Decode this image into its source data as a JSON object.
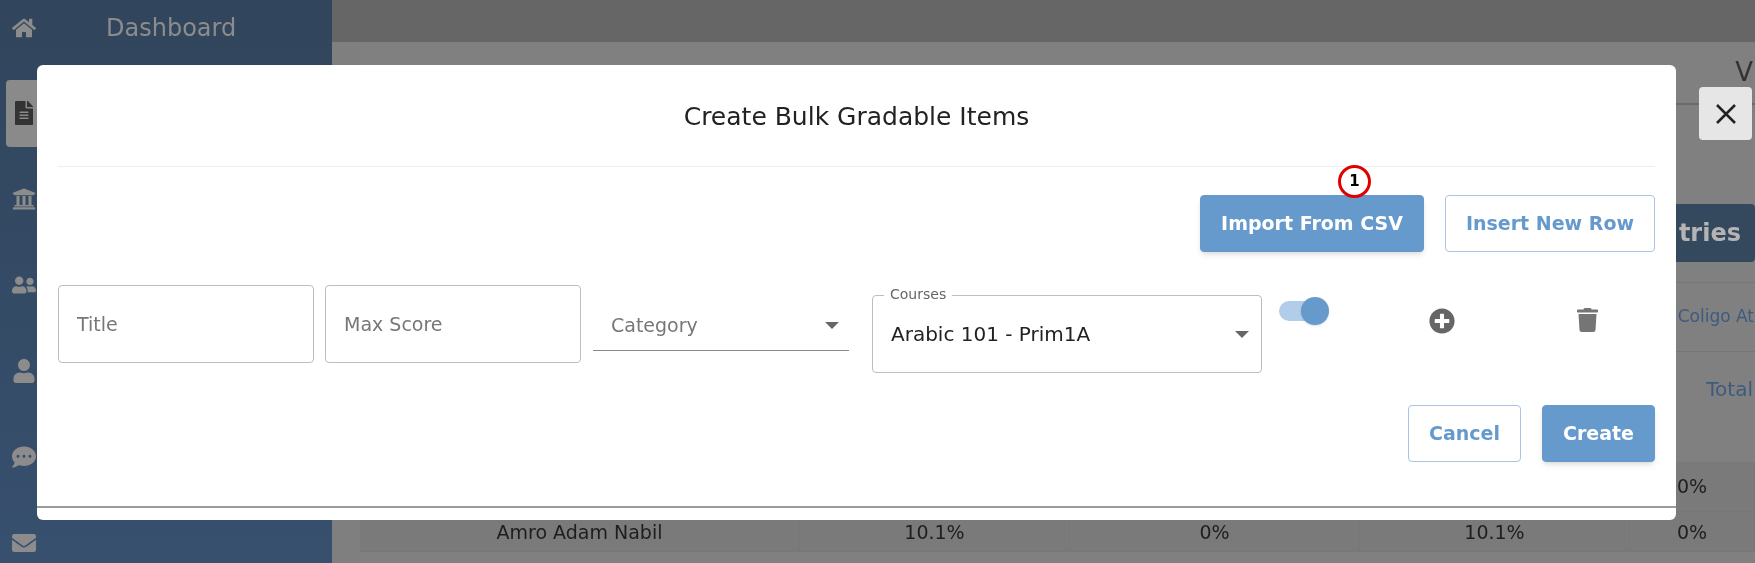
{
  "sidebar": {
    "items": [
      {
        "kind": "home",
        "label": "Dashboard",
        "selected": false
      },
      {
        "kind": "document",
        "selected": true
      },
      {
        "kind": "bank",
        "selected": false
      },
      {
        "kind": "people",
        "selected": false
      },
      {
        "kind": "person",
        "selected": false
      },
      {
        "kind": "feedback",
        "selected": false
      },
      {
        "kind": "mail",
        "selected": false
      }
    ]
  },
  "page": {
    "heading": "V",
    "action_button": "tries",
    "tab": "Coligo At",
    "column_header": "Total",
    "rows": [
      {
        "cells": [
          "",
          "",
          "",
          "",
          "0%"
        ]
      },
      {
        "cells": [
          "Amro Adam Nabil",
          "10.1%",
          "0%",
          "10.1%",
          "0%"
        ]
      }
    ]
  },
  "dialog": {
    "title": "Create Bulk Gradable Items",
    "annotation": "1",
    "toolbar": [
      {
        "label": "Import From CSV",
        "kind": "primary"
      },
      {
        "label": "Insert New Row",
        "kind": "outline"
      }
    ],
    "row": {
      "title_placeholder": "Title",
      "max_score_placeholder": "Max Score",
      "category_placeholder": "Category",
      "courses_label": "Courses",
      "courses_value": "Arabic 101 - Prim1A",
      "toggle_on": true
    },
    "footer": [
      {
        "label": "Cancel",
        "kind": "outline"
      },
      {
        "label": "Create",
        "kind": "primary"
      }
    ]
  }
}
